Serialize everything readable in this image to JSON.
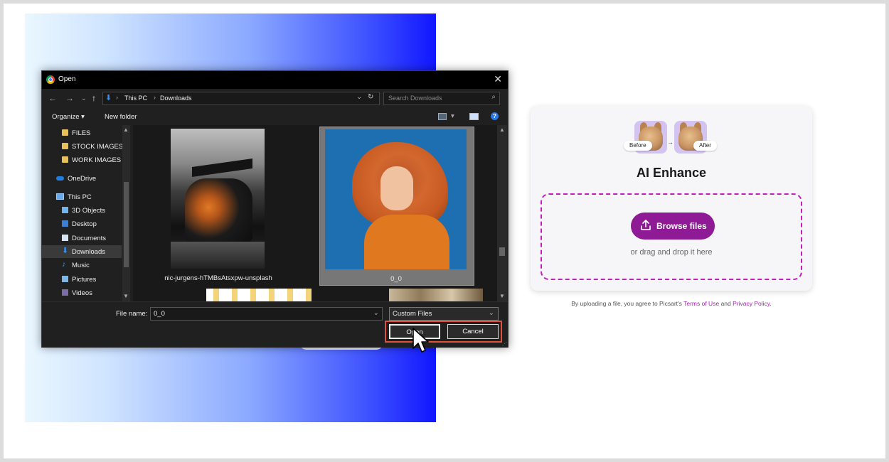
{
  "dialog": {
    "title": "Open",
    "close": "✕",
    "address": {
      "crumbs": [
        "This PC",
        "Downloads"
      ]
    },
    "search_placeholder": "Search Downloads",
    "toolbar": {
      "organize": "Organize ▾",
      "new_folder": "New folder",
      "help": "?"
    },
    "sidebar": [
      {
        "label": "FILES",
        "icon": "folder-icon"
      },
      {
        "label": "STOCK IMAGES",
        "icon": "folder-icon"
      },
      {
        "label": "WORK IMAGES",
        "icon": "folder-icon"
      },
      {
        "label": "OneDrive",
        "icon": "cloud-icon"
      },
      {
        "label": "This PC",
        "icon": "computer-icon"
      },
      {
        "label": "3D Objects",
        "icon": "cube-icon"
      },
      {
        "label": "Desktop",
        "icon": "desktop-icon"
      },
      {
        "label": "Documents",
        "icon": "document-icon"
      },
      {
        "label": "Downloads",
        "icon": "download-icon",
        "selected": true
      },
      {
        "label": "Music",
        "icon": "music-icon"
      },
      {
        "label": "Pictures",
        "icon": "pictures-icon"
      },
      {
        "label": "Videos",
        "icon": "videos-icon"
      }
    ],
    "files": [
      {
        "name": "nic-jurgens-hTMBsAtsxpw-unsplash"
      },
      {
        "name": "0_0",
        "selected": true
      }
    ],
    "file_name_label": "File name:",
    "file_name_value": "0_0",
    "file_type": "Custom Files",
    "open_label": "Open",
    "cancel_label": "Cancel"
  },
  "card": {
    "before_label": "Before",
    "after_label": "After",
    "title": "AI Enhance",
    "browse_label": "Browse files",
    "drag_text": "or drag and drop it here"
  },
  "terms": {
    "prefix": "By uploading a file, you agree to Picsart's",
    "terms_link": "Terms of Use",
    "and": "and",
    "privacy_link": "Privacy Policy."
  },
  "colors": {
    "accent": "#8e1a96",
    "dashed_border": "#c21ec0",
    "highlight_box": "#e0503b",
    "dialog_bg": "#202020"
  }
}
